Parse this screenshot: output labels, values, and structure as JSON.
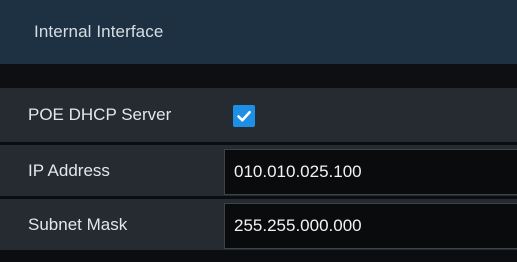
{
  "header": {
    "title": "Internal Interface"
  },
  "poe_dhcp": {
    "label": "POE DHCP Server",
    "checked": true
  },
  "ip_address": {
    "label": "IP Address",
    "value": "010.010.025.100"
  },
  "subnet_mask": {
    "label": "Subnet Mask",
    "value": "255.255.000.000"
  },
  "colors": {
    "header_bg": "#1e3142",
    "row_bg": "#262b31",
    "field_bg": "#0a0b0d",
    "checkbox_accent": "#1e8fe6",
    "text": "#e4e7ea"
  },
  "icons": {
    "checkbox": "checkmark-icon"
  }
}
